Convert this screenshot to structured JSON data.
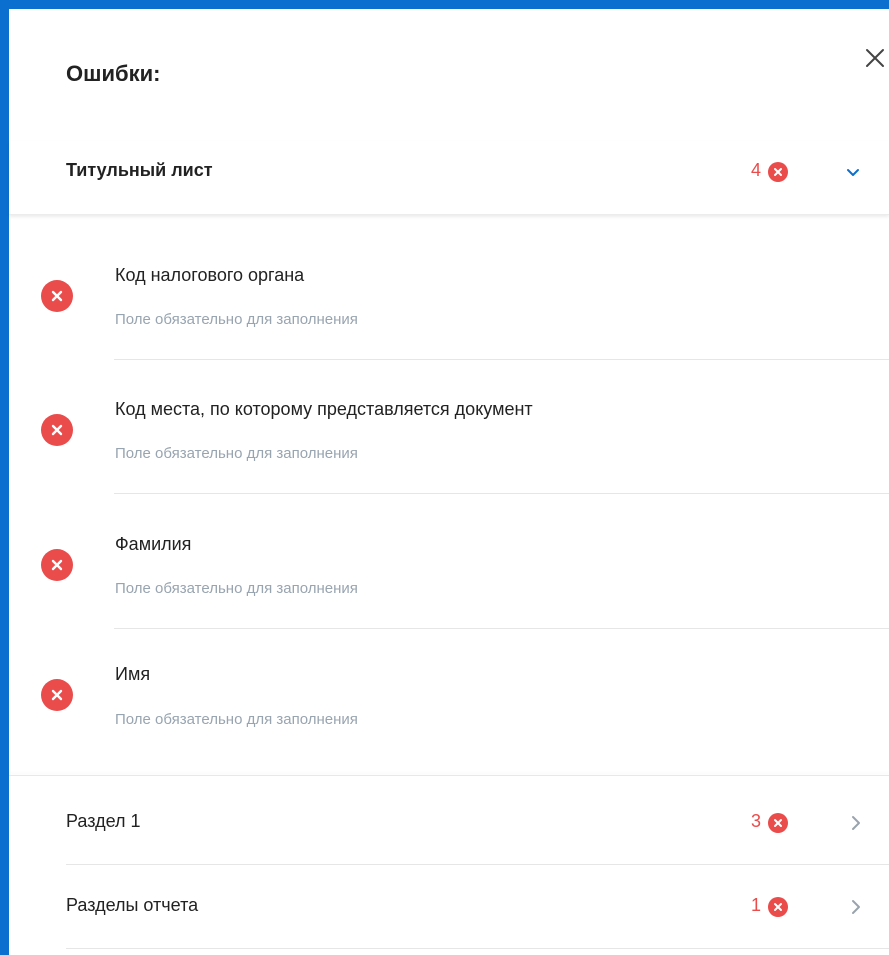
{
  "dialog": {
    "title": "Ошибки:"
  },
  "expanded_section": {
    "label": "Титульный лист",
    "count": "4",
    "errors": [
      {
        "field": "Код налогового органа",
        "hint": "Поле обязательно для заполнения"
      },
      {
        "field": "Код места, по которому представляется документ",
        "hint": "Поле обязательно для заполнения"
      },
      {
        "field": "Фамилия",
        "hint": "Поле обязательно для заполнения"
      },
      {
        "field": "Имя",
        "hint": "Поле обязательно для заполнения"
      }
    ]
  },
  "sections": [
    {
      "label": "Раздел 1",
      "count": "3"
    },
    {
      "label": "Разделы отчета",
      "count": "1"
    }
  ],
  "colors": {
    "accent": "#0a6fcf",
    "error": "#ea4b4b",
    "hint": "#98a4b0"
  }
}
